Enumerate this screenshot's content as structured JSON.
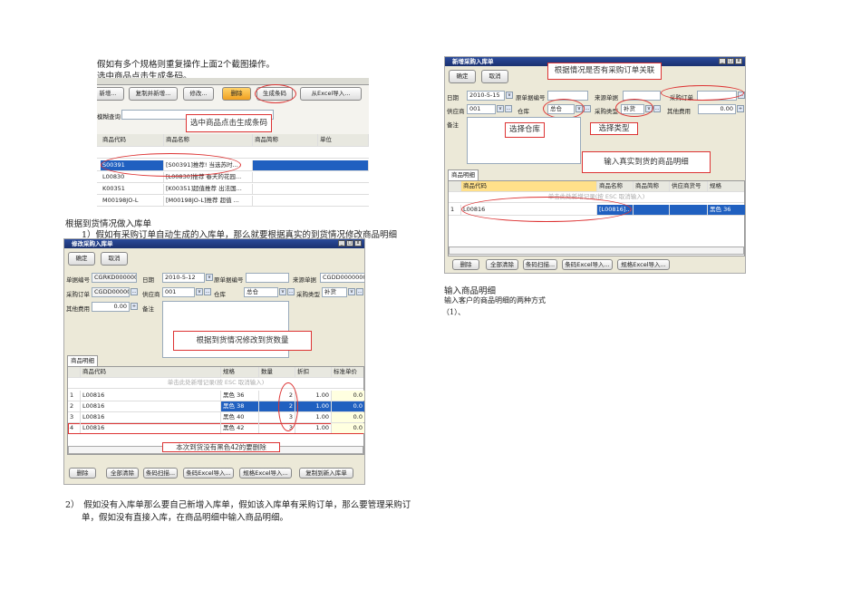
{
  "text": {
    "line1": "假如有多个规格则重复操作上面2个截图操作。",
    "line2": "选中商品点击生成条码。",
    "line3": "根据到货情况做入库单",
    "line4": "1）假如有采购订单自动生成的入库单，那么就要根据真实的到货情况修改商品明细",
    "line5a": "2）　假如没有入库单那么要自己新增入库单，假如该入库单有采购订单，那么要管理采购订",
    "line5b": "单，假如没有直接入库，在商品明细中输入商品明细。",
    "line6": "输入商品明细",
    "line7": "输入客户的商品明细的两种方式",
    "line8": "（1）、"
  },
  "shot1": {
    "buttons": [
      "新增...",
      "复制并新增...",
      "修改...",
      "删除",
      "生成条码",
      "从Excel导入..."
    ],
    "query_label": "模糊查询",
    "callout": "选中商品点击生成条码",
    "columns": [
      "商品代码",
      "商品名称",
      "商品简称",
      "单位"
    ],
    "rows": [
      [
        "S00391",
        "[S00391]推荐! 当选苏时..."
      ],
      [
        "L00830",
        "[L00830]推荐 春天的花园..."
      ],
      [
        "K00351",
        "[K00351]超值推荐 出法国..."
      ],
      [
        "M00198JO-L",
        "[M00198JO-L]推荐 超值 ..."
      ]
    ]
  },
  "shot2": {
    "title": "修改采购入库单",
    "ok": "确定",
    "cancel": "取消",
    "fields": {
      "doc_no_label": "单据编号",
      "doc_no": "CGRKD000000C",
      "date_label": "日期",
      "date": "2010-5-12",
      "orig_label": "原单据编号",
      "source_label": "来源单据",
      "source": "CGDD00000002",
      "po_label": "采购订单",
      "po": "CGDD00000",
      "supplier_label": "供应商",
      "supplier": "001",
      "wh_label": "仓库",
      "wh": "总仓",
      "type_label": "采购类型",
      "type": "补货",
      "fee_label": "其他费用",
      "fee": "0.00",
      "remark_label": "备注"
    },
    "callout1": "根据到货情况修改到货数量",
    "callout2": "本次到货没有黑色42的要删除",
    "tab": "商品明细",
    "columns": [
      "商品代码",
      "规格",
      "数量",
      "折扣",
      "标准单价"
    ],
    "new_row_hint": "单击此处新增记录(按 ESC 取消输入)",
    "rows": [
      [
        "1",
        "L00816",
        "黑色 36",
        "2",
        "1.00",
        "0.0"
      ],
      [
        "2",
        "L00816",
        "黑色 38",
        "2",
        "1.00",
        "0.0"
      ],
      [
        "3",
        "L00816",
        "黑色 40",
        "3",
        "1.00",
        "0.0"
      ],
      [
        "4",
        "L00816",
        "黑色 42",
        "3",
        "1.00",
        "0.0"
      ]
    ],
    "buttons": [
      "删除",
      "全部清除",
      "条码扫描...",
      "条码Excel导入...",
      "规格Excel导入...",
      "复制到新入库单"
    ]
  },
  "shot3": {
    "title": "新增采购入库单",
    "ok": "确定",
    "cancel": "取消",
    "fields": {
      "date_label": "日期",
      "date": "2010-5-15",
      "orig_label": "原单据编号",
      "source_label": "来源单据",
      "po_label": "采购订单",
      "supplier_label": "供应商",
      "supplier": "001",
      "wh_label": "仓库",
      "wh": "总仓",
      "type_label": "采购类型",
      "type": "补货",
      "fee_label": "其他费用",
      "fee": "0.00",
      "remark_label": "备注"
    },
    "callout1": "根据情况是否有采购订单关联",
    "callout2": "选择仓库",
    "callout3": "选择类型",
    "callout4": "输入真实到货的商品明细",
    "tab": "商品明细",
    "columns": [
      "商品代码",
      "商品名称",
      "商品简称",
      "供应商货号",
      "规格"
    ],
    "new_row_hint": "单击此处新增记录(按 ESC 取消输入)",
    "rows": [
      [
        "1",
        "L00816",
        "[L00816]...",
        "",
        "",
        "黑色 36"
      ]
    ],
    "buttons": [
      "删除",
      "全部清除",
      "条码扫描...",
      "条码Excel导入...",
      "规格Excel导入..."
    ]
  }
}
